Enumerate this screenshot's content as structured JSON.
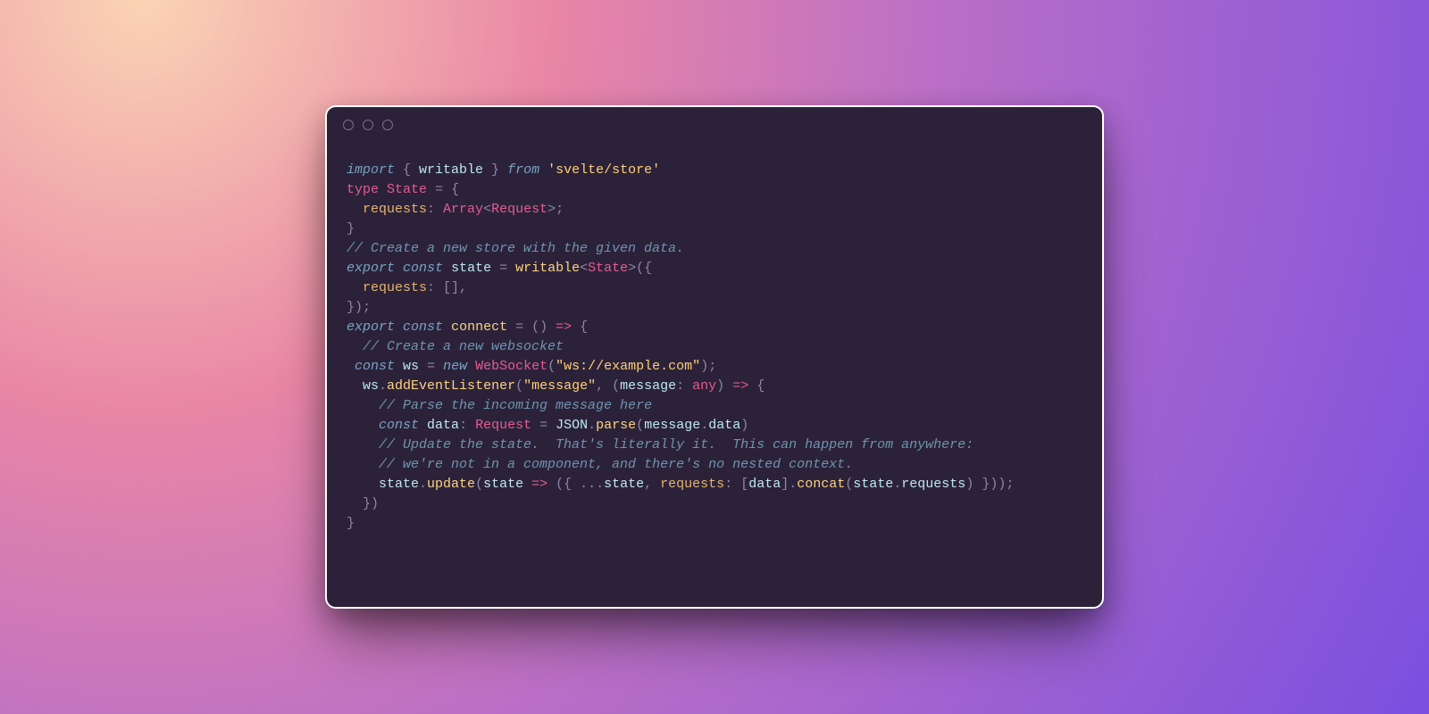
{
  "theme": {
    "window_bg": "#2b223a",
    "border": "#ffffff",
    "comment": "#6f94ad",
    "keyword_italic": "#7aa2c4",
    "keyword": "#e65a8e",
    "string": "#ffcf73",
    "identifier": "#bfe8ec",
    "function": "#ffd27d",
    "type": "#e65a8e",
    "punctuation": "#8f85a6",
    "property": "#e6b36b"
  },
  "code": {
    "lines": [
      [
        {
          "c": "kw-it",
          "t": "import"
        },
        {
          "c": "punc",
          "t": " { "
        },
        {
          "c": "ident",
          "t": "writable"
        },
        {
          "c": "punc",
          "t": " } "
        },
        {
          "c": "kw-it",
          "t": "from"
        },
        {
          "c": "",
          "t": " "
        },
        {
          "c": "str",
          "t": "'svelte/store'"
        }
      ],
      [
        {
          "c": "kw",
          "t": "type"
        },
        {
          "c": "",
          "t": " "
        },
        {
          "c": "type",
          "t": "State"
        },
        {
          "c": "",
          "t": " "
        },
        {
          "c": "punc",
          "t": "= {"
        }
      ],
      [
        {
          "c": "",
          "t": "  "
        },
        {
          "c": "attr",
          "t": "requests"
        },
        {
          "c": "punc",
          "t": ": "
        },
        {
          "c": "type",
          "t": "Array"
        },
        {
          "c": "punc",
          "t": "<"
        },
        {
          "c": "type",
          "t": "Request"
        },
        {
          "c": "punc",
          "t": ">;"
        }
      ],
      [
        {
          "c": "punc",
          "t": "}"
        }
      ],
      [
        {
          "c": "com",
          "t": "// Create a new store with the given data."
        }
      ],
      [
        {
          "c": "kw-it",
          "t": "export"
        },
        {
          "c": "",
          "t": " "
        },
        {
          "c": "kw-it",
          "t": "const"
        },
        {
          "c": "",
          "t": " "
        },
        {
          "c": "ident",
          "t": "state"
        },
        {
          "c": "",
          "t": " "
        },
        {
          "c": "punc",
          "t": "= "
        },
        {
          "c": "fn",
          "t": "writable"
        },
        {
          "c": "punc",
          "t": "<"
        },
        {
          "c": "type",
          "t": "State"
        },
        {
          "c": "punc",
          "t": ">({"
        }
      ],
      [
        {
          "c": "",
          "t": "  "
        },
        {
          "c": "attr",
          "t": "requests"
        },
        {
          "c": "punc",
          "t": ": [],"
        }
      ],
      [
        {
          "c": "punc",
          "t": "});"
        }
      ],
      [
        {
          "c": "kw-it",
          "t": "export"
        },
        {
          "c": "",
          "t": " "
        },
        {
          "c": "kw-it",
          "t": "const"
        },
        {
          "c": "",
          "t": " "
        },
        {
          "c": "fn",
          "t": "connect"
        },
        {
          "c": "",
          "t": " "
        },
        {
          "c": "punc",
          "t": "= () "
        },
        {
          "c": "kw",
          "t": "=>"
        },
        {
          "c": "punc",
          "t": " {"
        }
      ],
      [
        {
          "c": "",
          "t": "  "
        },
        {
          "c": "com",
          "t": "// Create a new websocket"
        }
      ],
      [
        {
          "c": "",
          "t": " "
        },
        {
          "c": "kw-it",
          "t": "const"
        },
        {
          "c": "",
          "t": " "
        },
        {
          "c": "ident",
          "t": "ws"
        },
        {
          "c": "",
          "t": " "
        },
        {
          "c": "punc",
          "t": "= "
        },
        {
          "c": "kw-it",
          "t": "new"
        },
        {
          "c": "",
          "t": " "
        },
        {
          "c": "cls",
          "t": "WebSocket"
        },
        {
          "c": "punc",
          "t": "("
        },
        {
          "c": "str",
          "t": "\"ws://example.com\""
        },
        {
          "c": "punc",
          "t": ");"
        }
      ],
      [
        {
          "c": "",
          "t": "  "
        },
        {
          "c": "ident",
          "t": "ws"
        },
        {
          "c": "punc",
          "t": "."
        },
        {
          "c": "fn",
          "t": "addEventListener"
        },
        {
          "c": "punc",
          "t": "("
        },
        {
          "c": "str",
          "t": "\"message\""
        },
        {
          "c": "punc",
          "t": ", ("
        },
        {
          "c": "ident",
          "t": "message"
        },
        {
          "c": "punc",
          "t": ": "
        },
        {
          "c": "type",
          "t": "any"
        },
        {
          "c": "punc",
          "t": ") "
        },
        {
          "c": "kw",
          "t": "=>"
        },
        {
          "c": "punc",
          "t": " {"
        }
      ],
      [
        {
          "c": "",
          "t": "    "
        },
        {
          "c": "com",
          "t": "// Parse the incoming message here"
        }
      ],
      [
        {
          "c": "",
          "t": "    "
        },
        {
          "c": "kw-it",
          "t": "const"
        },
        {
          "c": "",
          "t": " "
        },
        {
          "c": "ident",
          "t": "data"
        },
        {
          "c": "punc",
          "t": ": "
        },
        {
          "c": "type",
          "t": "Request"
        },
        {
          "c": "",
          "t": " "
        },
        {
          "c": "punc",
          "t": "= "
        },
        {
          "c": "ident",
          "t": "JSON"
        },
        {
          "c": "punc",
          "t": "."
        },
        {
          "c": "fn",
          "t": "parse"
        },
        {
          "c": "punc",
          "t": "("
        },
        {
          "c": "ident",
          "t": "message"
        },
        {
          "c": "punc",
          "t": "."
        },
        {
          "c": "ident",
          "t": "data"
        },
        {
          "c": "punc",
          "t": ")"
        }
      ],
      [
        {
          "c": "",
          "t": "    "
        },
        {
          "c": "com",
          "t": "// Update the state.  That's literally it.  This can happen from anywhere:"
        }
      ],
      [
        {
          "c": "",
          "t": "    "
        },
        {
          "c": "com",
          "t": "// we're not in a component, and there's no nested context."
        }
      ],
      [
        {
          "c": "",
          "t": "    "
        },
        {
          "c": "ident",
          "t": "state"
        },
        {
          "c": "punc",
          "t": "."
        },
        {
          "c": "fn",
          "t": "update"
        },
        {
          "c": "punc",
          "t": "("
        },
        {
          "c": "ident",
          "t": "state"
        },
        {
          "c": "",
          "t": " "
        },
        {
          "c": "kw",
          "t": "=>"
        },
        {
          "c": "punc",
          "t": " ({ ..."
        },
        {
          "c": "ident",
          "t": "state"
        },
        {
          "c": "punc",
          "t": ", "
        },
        {
          "c": "attr",
          "t": "requests"
        },
        {
          "c": "punc",
          "t": ": ["
        },
        {
          "c": "ident",
          "t": "data"
        },
        {
          "c": "punc",
          "t": "]."
        },
        {
          "c": "fn",
          "t": "concat"
        },
        {
          "c": "punc",
          "t": "("
        },
        {
          "c": "ident",
          "t": "state"
        },
        {
          "c": "punc",
          "t": "."
        },
        {
          "c": "ident",
          "t": "requests"
        },
        {
          "c": "punc",
          "t": ") }));"
        }
      ],
      [
        {
          "c": "",
          "t": "  "
        },
        {
          "c": "punc",
          "t": "})"
        }
      ],
      [
        {
          "c": "punc",
          "t": "}"
        }
      ]
    ]
  }
}
